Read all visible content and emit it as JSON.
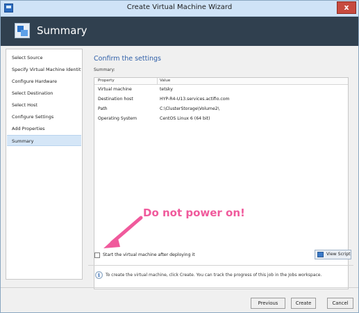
{
  "window": {
    "title": "Create Virtual Machine Wizard",
    "close_label": "x"
  },
  "header": {
    "title": "Summary",
    "icon": "wizard-icon"
  },
  "sidebar": {
    "items": [
      {
        "label": "Select Source"
      },
      {
        "label": "Specify Virtual Machine Identity"
      },
      {
        "label": "Configure Hardware"
      },
      {
        "label": "Select Destination"
      },
      {
        "label": "Select Host"
      },
      {
        "label": "Configure Settings"
      },
      {
        "label": "Add Properties"
      },
      {
        "label": "Summary",
        "active": true
      }
    ]
  },
  "main": {
    "section_title": "Confirm the settings",
    "summary_label": "Summary:",
    "table": {
      "headers": [
        "Property",
        "Value"
      ],
      "rows": [
        [
          "Virtual machine",
          "tetsky"
        ],
        [
          "Destination host",
          "HYP-R4-U13.services.actifio.com"
        ],
        [
          "Path",
          "C:\\ClusterStorage\\Volume2\\"
        ],
        [
          "Operating System",
          "CentOS Linux 6 (64 bit)"
        ]
      ]
    },
    "annotation": "Do not power on!",
    "annotation_color": "#f05a9c",
    "start_checkbox": {
      "label": "Start the virtual machine after deploying it",
      "checked": false
    },
    "view_script_label": "View Script",
    "info_text": "To create the virtual machine, click Create.  You can track the progress of this job in the Jobs workspace."
  },
  "footer": {
    "previous": "Previous",
    "create": "Create",
    "cancel": "Cancel"
  }
}
